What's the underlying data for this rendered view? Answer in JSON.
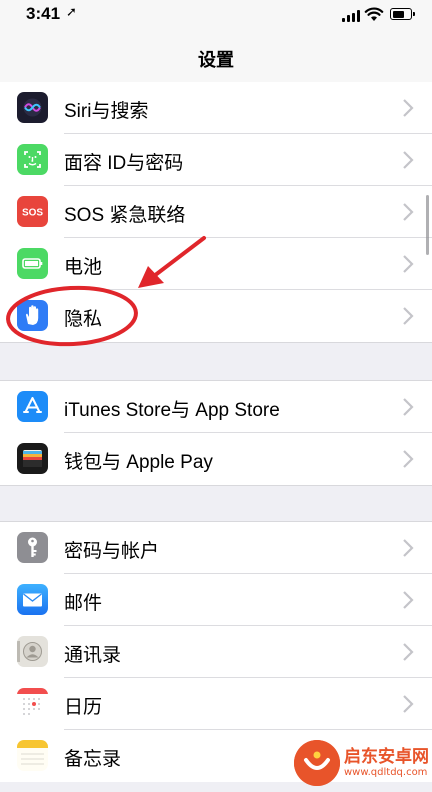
{
  "status_bar": {
    "time": "3:41"
  },
  "nav": {
    "title": "设置"
  },
  "groups": [
    [
      {
        "label": "Siri与搜索",
        "icon": "siri-icon"
      },
      {
        "label": "面容 ID与密码",
        "icon": "face-id-icon"
      },
      {
        "label": "SOS 紧急联络",
        "icon": "sos-icon",
        "icon_text": "SOS"
      },
      {
        "label": "电池",
        "icon": "battery-icon"
      },
      {
        "label": "隐私",
        "icon": "privacy-hand-icon"
      }
    ],
    [
      {
        "label": "iTunes Store与 App Store",
        "icon": "app-store-icon"
      },
      {
        "label": "钱包与 Apple Pay",
        "icon": "wallet-icon"
      }
    ],
    [
      {
        "label": "密码与帐户",
        "icon": "key-icon"
      },
      {
        "label": "邮件",
        "icon": "mail-icon"
      },
      {
        "label": "通讯录",
        "icon": "contacts-icon"
      },
      {
        "label": "日历",
        "icon": "calendar-icon"
      },
      {
        "label": "备忘录",
        "icon": "notes-icon"
      }
    ]
  ],
  "watermark": {
    "title": "启东安卓网",
    "url": "www.qdltdq.com"
  },
  "colors": {
    "annotation": "#e0262b",
    "sos": "#e8453c",
    "battery": "#4cd964",
    "privacy": "#2f7cf6",
    "app_store": "#1d8cf8",
    "mail": "#1a8cf5"
  }
}
